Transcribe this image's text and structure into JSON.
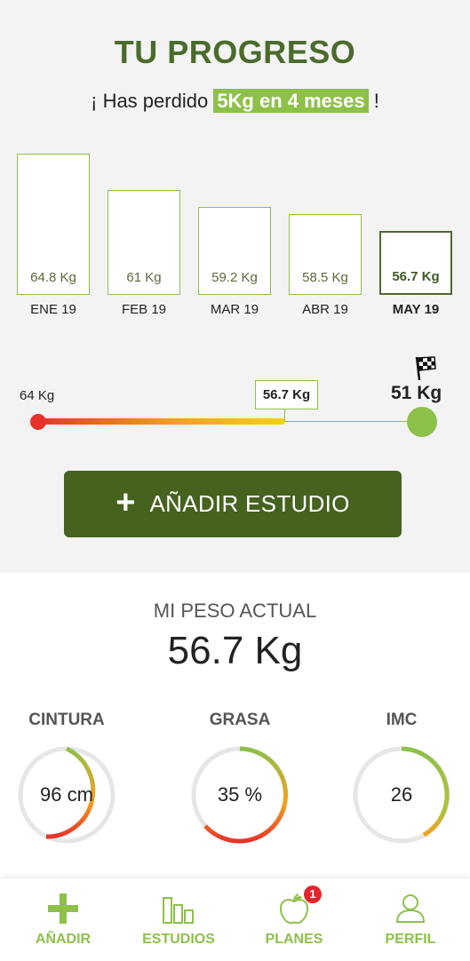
{
  "header": {
    "title": "TU PROGRESO",
    "subtitle_prefix": "¡ Has perdido ",
    "subtitle_highlight": "5Kg en 4 meses",
    "subtitle_suffix": " !"
  },
  "chart_data": {
    "type": "bar",
    "categories": [
      "ENE 19",
      "FEB 19",
      "MAR 19",
      "ABR 19",
      "MAY 19"
    ],
    "values": [
      64.8,
      61,
      59.2,
      58.5,
      56.7
    ],
    "value_labels": [
      "64.8 Kg",
      "61 Kg",
      "59.2 Kg",
      "58.5 Kg",
      "56.7 Kg"
    ],
    "highlighted_category": "MAY 19"
  },
  "progress": {
    "start_label": "64 Kg",
    "current_label": "56.7 Kg",
    "goal_label": "51 Kg",
    "start_value": 64,
    "current_value": 56.7,
    "goal_value": 51
  },
  "actions": {
    "add_study_label": "AÑADIR ESTUDIO",
    "add_study_icon": "plus-icon"
  },
  "current_weight": {
    "title": "MI PESO ACTUAL",
    "value": "56.7 Kg"
  },
  "metrics": [
    {
      "name": "CINTURA",
      "value": "96 cm"
    },
    {
      "name": "GRASA",
      "value": "35 %"
    },
    {
      "name": "IMC",
      "value": "26"
    }
  ],
  "bottom_nav": {
    "items": [
      {
        "label": "AÑADIR",
        "icon": "plus-icon"
      },
      {
        "label": "ESTUDIOS",
        "icon": "bar-chart-icon"
      },
      {
        "label": "PLANES",
        "icon": "apple-icon",
        "badge": "1"
      },
      {
        "label": "PERFIL",
        "icon": "user-icon"
      }
    ]
  },
  "colors": {
    "brand_dark": "#45621f",
    "brand_green": "#8dc14a",
    "title_green": "#4b6b2c",
    "red": "#e8332a",
    "orange": "#f6a01d",
    "badge_red": "#e4262c"
  }
}
